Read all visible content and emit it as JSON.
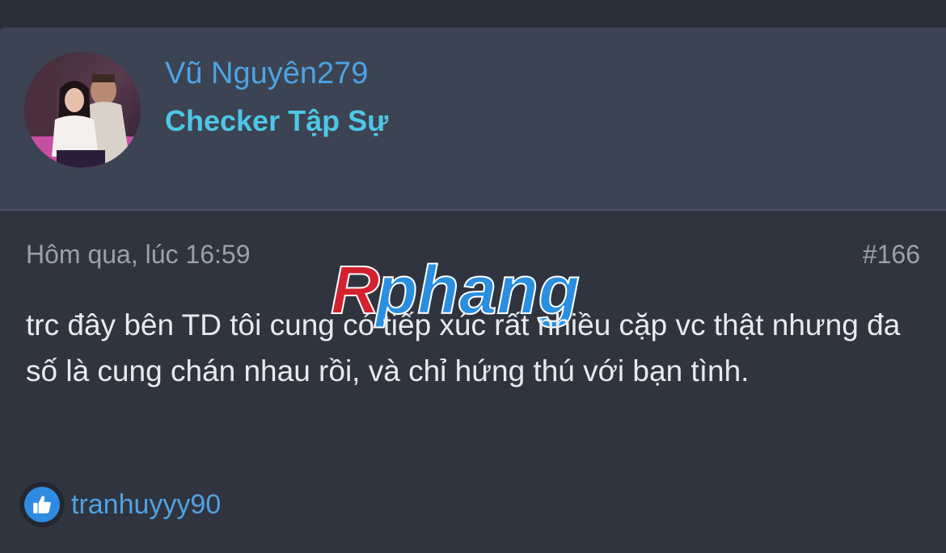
{
  "post": {
    "author": {
      "name": "Vũ Nguyên279",
      "title": "Checker Tập Sự",
      "avatar_icon": "user-avatar-photo"
    },
    "meta": {
      "date": "Hôm qua, lúc 16:59",
      "number": "#166"
    },
    "body": "trc đây bên TD tôi cung có tiếp xúc rất nhiều cặp vc thật nhưng đa số là cung chán nhau rồi, và chỉ hứng thú với bạn tình.",
    "reactions": {
      "icon": "thumbs-up-icon",
      "user": "tranhuyyy90"
    }
  },
  "watermark": {
    "text": "Rphang",
    "colors": {
      "first_letter": "#d3212f",
      "rest": "#2a8fe0"
    }
  },
  "colors": {
    "background": "#2b2f39",
    "header_bg": "#3c4352",
    "link": "#4da3e3",
    "title": "#4fc6e6",
    "body_text": "#e8eaee",
    "meta_text": "#9aa1ad",
    "like_badge": "#2f8be0"
  }
}
